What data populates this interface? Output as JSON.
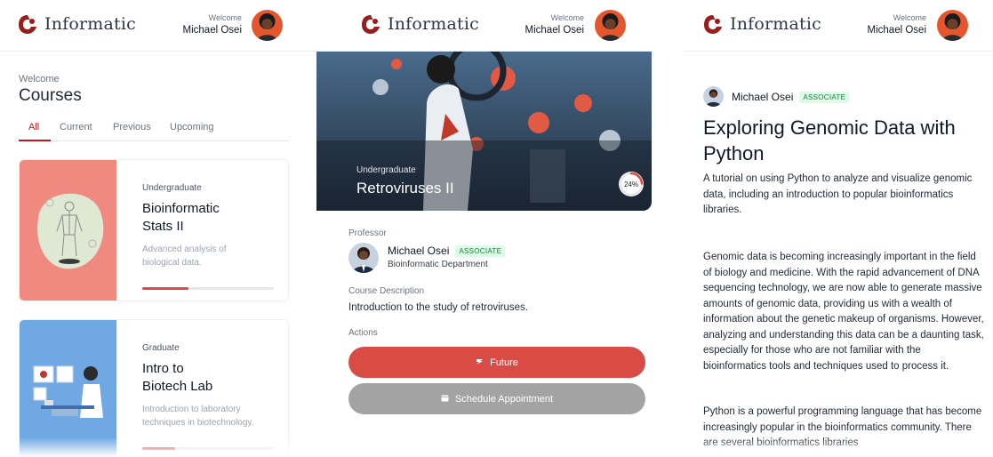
{
  "brand": {
    "name": "Informatic"
  },
  "header": {
    "welcome_label": "Welcome",
    "user_name": "Michael Osei"
  },
  "courses_page": {
    "welcome": "Welcome",
    "title": "Courses",
    "tabs": [
      {
        "label": "All",
        "active": true
      },
      {
        "label": "Current",
        "active": false
      },
      {
        "label": "Previous",
        "active": false
      },
      {
        "label": "Upcoming",
        "active": false
      }
    ],
    "cards": [
      {
        "level": "Undergraduate",
        "title_line1": "Bioinformatic",
        "title_line2": "Stats II",
        "desc_line1": "Advanced analysis of",
        "desc_line2": "biological data.",
        "progress": 0.35,
        "thumb_color": "#f08a80"
      },
      {
        "level": "Graduate",
        "title_line1": "Intro to",
        "title_line2": "Biotech Lab",
        "desc_line1": "Introduction to laboratory",
        "desc_line2": "techniques in biotechnology.",
        "progress": 0.25,
        "thumb_color": "#6fa8e3"
      }
    ]
  },
  "course_detail": {
    "level": "Undergraduate",
    "title": "Retroviruses II",
    "progress_label": "24%",
    "progress": 0.24,
    "professor_label": "Professor",
    "professor_name": "Michael Osei",
    "professor_badge": "ASSOCIATE",
    "professor_dept": "Bioinformatic Department",
    "description_label": "Course Description",
    "description": "Introduction to the study of retroviruses.",
    "actions_label": "Actions",
    "future_button": "Future",
    "schedule_button": "Schedule Appointment"
  },
  "article": {
    "author": "Michael Osei",
    "author_badge": "ASSOCIATE",
    "title_line1": "Exploring Genomic Data with",
    "title_line2": "Python",
    "subtitle": "A tutorial on using Python to analyze and visualize genomic data, including an introduction to popular bioinformatics libraries.",
    "paragraph1": "Genomic data is becoming increasingly important in the field of biology and medicine. With the rapid advancement of DNA sequencing technology, we are now able to generate massive amounts of genomic data, providing us with a wealth of information about the genetic makeup of organisms. However, analyzing and understanding this data can be a daunting task, especially for those who are not familiar with the bioinformatics tools and techniques used to process it.",
    "paragraph2": "Python is a powerful programming language that has become increasingly popular in the bioinformatics community. There are several bioinformatics libraries"
  },
  "colors": {
    "accent": "#b91c1c",
    "button_primary": "#d94b45",
    "button_secondary": "#a3a3a3",
    "badge_bg": "#dcfce7",
    "badge_text": "#15803d"
  },
  "icons": [
    "informatic-logo",
    "avatar",
    "future-icon",
    "calendar-icon"
  ]
}
